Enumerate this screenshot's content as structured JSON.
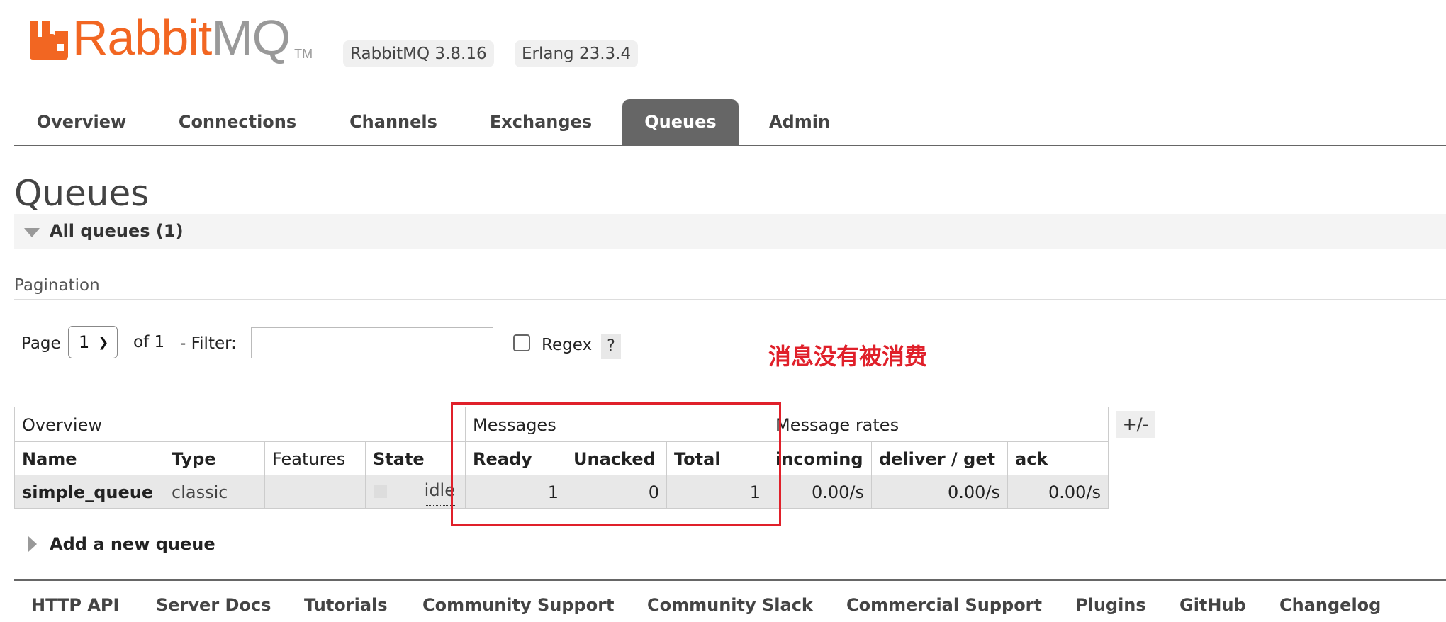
{
  "header": {
    "brand_primary": "Rabbit",
    "brand_secondary": "MQ",
    "brand_tm": "TM",
    "rabbitmq_version": "RabbitMQ 3.8.16",
    "erlang_version": "Erlang 23.3.4",
    "brand_color": "#f26622"
  },
  "tabs": [
    {
      "label": "Overview"
    },
    {
      "label": "Connections"
    },
    {
      "label": "Channels"
    },
    {
      "label": "Exchanges"
    },
    {
      "label": "Queues",
      "active": true
    },
    {
      "label": "Admin"
    }
  ],
  "page": {
    "title": "Queues",
    "section_title": "All queues (1)"
  },
  "pagination": {
    "heading": "Pagination",
    "page_label": "Page",
    "page_value": "1",
    "of_label": "of 1",
    "filter_label": "- Filter:",
    "filter_value": "",
    "regex_label": "Regex",
    "regex_checked": false,
    "help_label": "?"
  },
  "annotation": {
    "text": "消息没有被消费",
    "color": "#e0202a"
  },
  "table": {
    "groups": {
      "overview": "Overview",
      "messages": "Messages",
      "message_rates": "Message rates"
    },
    "columns": {
      "name": "Name",
      "type": "Type",
      "features": "Features",
      "state": "State",
      "ready": "Ready",
      "unacked": "Unacked",
      "total": "Total",
      "incoming": "incoming",
      "deliver_get": "deliver / get",
      "ack": "ack"
    },
    "rows": [
      {
        "name": "simple_queue",
        "type": "classic",
        "features": "",
        "state": "idle",
        "ready": "1",
        "unacked": "0",
        "total": "1",
        "incoming": "0.00/s",
        "deliver_get": "0.00/s",
        "ack": "0.00/s"
      }
    ],
    "toggle_label": "+/-"
  },
  "add_queue": {
    "label": "Add a new queue"
  },
  "footer": {
    "links": [
      "HTTP API",
      "Server Docs",
      "Tutorials",
      "Community Support",
      "Community Slack",
      "Commercial Support",
      "Plugins",
      "GitHub",
      "Changelog"
    ]
  }
}
